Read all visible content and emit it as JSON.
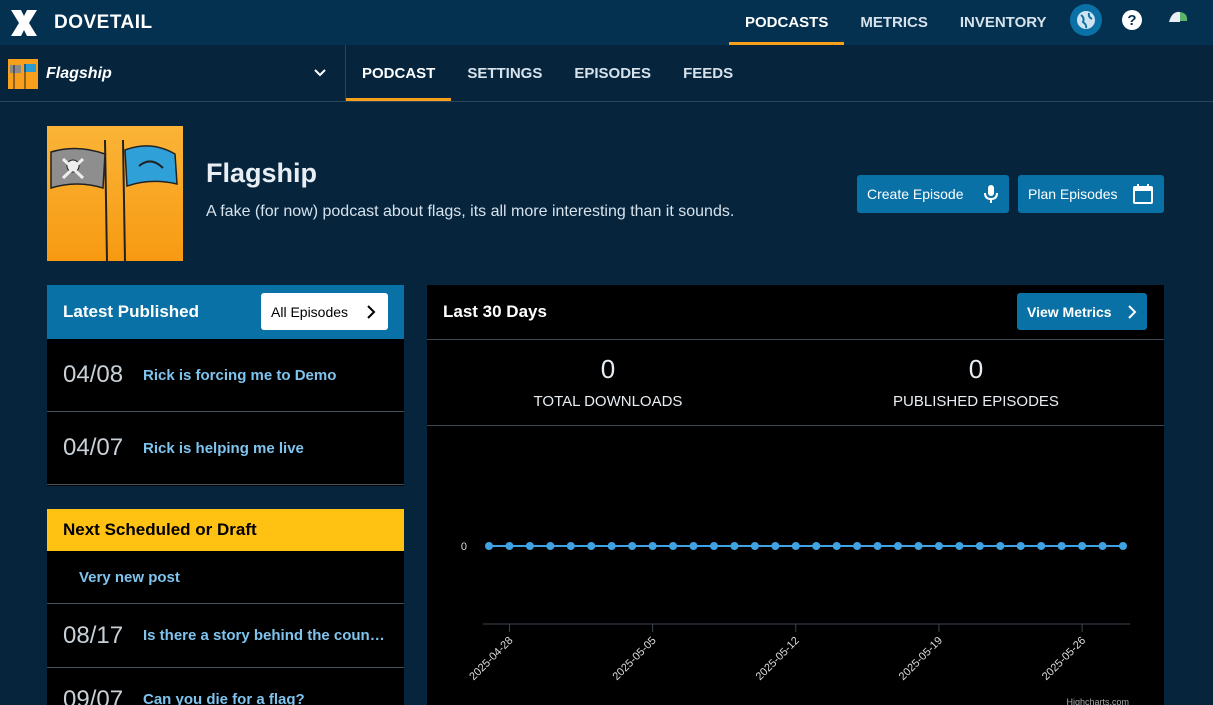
{
  "app": {
    "logo_text": "DOVETAIL"
  },
  "topnav": {
    "items": [
      "PODCASTS",
      "METRICS",
      "INVENTORY"
    ],
    "active": 0
  },
  "top_icons": [
    "globe-icon",
    "help-icon",
    "user-avatar-icon"
  ],
  "podcast_select": {
    "name": "Flagship"
  },
  "subnav": {
    "items": [
      "PODCAST",
      "SETTINGS",
      "EPISODES",
      "FEEDS"
    ],
    "active": 0
  },
  "podcast": {
    "title": "Flagship",
    "description": "A fake (for now) podcast about flags, its all more interesting than it sounds."
  },
  "actions": {
    "create_episode": "Create Episode",
    "plan_episodes": "Plan Episodes"
  },
  "latest": {
    "title": "Latest Published",
    "all_button": "All Episodes",
    "episodes": [
      {
        "date": "04/08",
        "title": "Rick is forcing me to Demo"
      },
      {
        "date": "04/07",
        "title": "Rick is helping me live"
      }
    ]
  },
  "scheduled": {
    "title": "Next Scheduled or Draft",
    "items": [
      {
        "date": "",
        "title": "Very new post"
      },
      {
        "date": "08/17",
        "title": "Is there a story behind the country flags?"
      },
      {
        "date": "09/07",
        "title": "Can you die for a flag?"
      }
    ]
  },
  "metrics": {
    "title": "Last 30 Days",
    "view_button": "View Metrics",
    "stats": [
      {
        "value": "0",
        "label": "TOTAL DOWNLOADS"
      },
      {
        "value": "0",
        "label": "PUBLISHED EPISODES"
      }
    ],
    "credit": "Highcharts.com"
  },
  "chart_data": {
    "type": "line",
    "x_ticks": [
      "2025-04-28",
      "2025-05-05",
      "2025-05-12",
      "2025-05-19",
      "2025-05-26"
    ],
    "y_ticks": [
      "0"
    ],
    "series": [
      {
        "values": [
          0,
          0,
          0,
          0,
          0,
          0,
          0,
          0,
          0,
          0,
          0,
          0,
          0,
          0,
          0,
          0,
          0,
          0,
          0,
          0,
          0,
          0,
          0,
          0,
          0,
          0,
          0,
          0,
          0,
          0,
          0,
          0
        ]
      }
    ],
    "color": "#3fa2e3"
  },
  "colors": {
    "accent": "#f8a01c",
    "primary": "#0a71a6",
    "yellow": "#ffc112",
    "link": "#7fc4ee"
  }
}
